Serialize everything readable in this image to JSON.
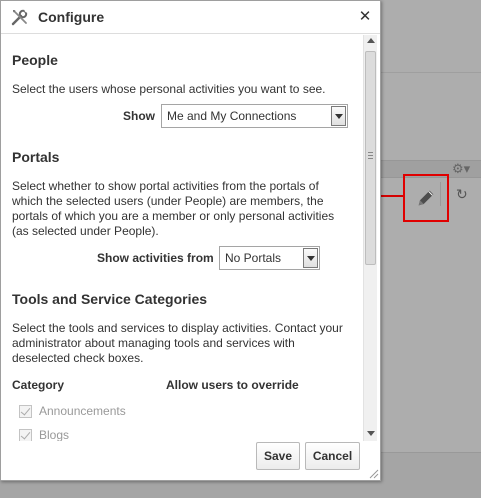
{
  "dialog": {
    "title": "Configure",
    "close_glyph": "✕",
    "people": {
      "heading": "People",
      "description": "Select the users whose personal activities you want to see.",
      "show_label": "Show",
      "show_value": "Me and My Connections"
    },
    "portals": {
      "heading": "Portals",
      "description": [
        "Select whether to show portal activities from the portals of",
        "which the selected users (under People) are members, the",
        "portals of which you are a member or only personal activities",
        "(as selected under People)."
      ],
      "show_from_label": "Show activities from",
      "show_from_value": "No Portals"
    },
    "tools": {
      "heading": "Tools and Service Categories",
      "description": [
        "Select the tools and services to display activities. Contact your",
        "administrator about managing tools and services with",
        "deselected check boxes."
      ],
      "col_category": "Category",
      "col_override": "Allow users to override",
      "categories": [
        {
          "label": "Announcements",
          "checked": true,
          "disabled": true
        },
        {
          "label": "Blogs",
          "checked": true,
          "disabled": true
        }
      ]
    },
    "save_label": "Save",
    "cancel_label": "Cancel"
  },
  "background": {
    "gear_glyph": "⚙▾",
    "refresh_glyph": "↻"
  },
  "colors": {
    "callout": "#e00000"
  },
  "icons": {
    "title": "wrench-screwdriver-icon",
    "callout": "pencil-icon"
  }
}
